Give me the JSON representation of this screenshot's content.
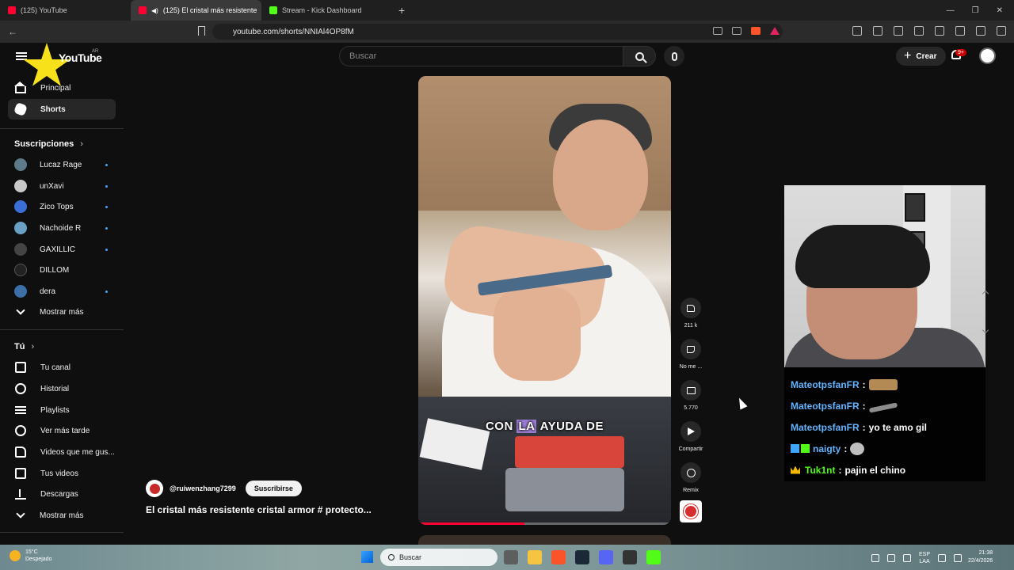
{
  "browser": {
    "tabs": [
      {
        "label": "(125) YouTube",
        "active": false
      },
      {
        "label": "(125) El cristal más resistente",
        "active": true
      },
      {
        "label": "Stream - Kick Dashboard",
        "active": false
      }
    ],
    "new_tab": "+",
    "url": "youtube.com/shorts/NNIAl4OP8fM"
  },
  "header": {
    "logo": "YouTube",
    "region": "AR",
    "search_placeholder": "Buscar",
    "create_label": "Crear",
    "notifications_badge": "9+"
  },
  "sidebar": {
    "main": [
      {
        "label": "Principal",
        "icon": "home-icon",
        "active": false
      },
      {
        "label": "Shorts",
        "icon": "shorts-icon",
        "active": true
      }
    ],
    "subscriptions_title": "Suscripciones",
    "subscriptions": [
      {
        "label": "Lucaz Rage",
        "color": "#5d7a8a",
        "live": true
      },
      {
        "label": "unXavi",
        "color": "#c9c9c9",
        "live": true
      },
      {
        "label": "Zico Tops",
        "color": "#3b6fd8",
        "live": true
      },
      {
        "label": "Nachoide R",
        "color": "#6aa0c4",
        "live": true
      },
      {
        "label": "GAXILLIC",
        "color": "#444444",
        "live": true
      },
      {
        "label": "DILLOM",
        "color": "#222222",
        "live": false
      },
      {
        "label": "dera",
        "color": "#3a6fa8",
        "live": true
      }
    ],
    "show_more_1": "Mostrar más",
    "you_title": "Tú",
    "you_items": [
      {
        "label": "Tu canal",
        "icon": "channel-icon"
      },
      {
        "label": "Historial",
        "icon": "history-icon"
      },
      {
        "label": "Playlists",
        "icon": "playlists-icon"
      },
      {
        "label": "Ver más tarde",
        "icon": "watch-later-icon"
      },
      {
        "label": "Videos que me gus...",
        "icon": "liked-videos-icon"
      },
      {
        "label": "Tus videos",
        "icon": "your-videos-icon"
      },
      {
        "label": "Descargas",
        "icon": "downloads-icon"
      }
    ],
    "show_more_2": "Mostrar más"
  },
  "short": {
    "caption_before": "CON",
    "caption_highlight": "LA",
    "caption_after": "AYUDA DE",
    "progress": 0.42,
    "channel": "@ruiwenzhang7299",
    "subscribe_label": "Suscribirse",
    "title": "El cristal más resistente cristal armor # protecto..."
  },
  "actions": {
    "likes": "211 k",
    "dislike": "No me ...",
    "comments": "5.770",
    "share": "Compartir",
    "remix": "Remix"
  },
  "chat": [
    {
      "user": "MateotpsfanFR",
      "text": "",
      "emote": "emote-a"
    },
    {
      "user": "MateotpsfanFR",
      "text": "",
      "emote": "emote-b"
    },
    {
      "user": "MateotpsfanFR",
      "text": "yo te amo gil",
      "emote": ""
    },
    {
      "user": "naigty",
      "text": "",
      "emote": "emote-c"
    },
    {
      "user": "Tuk1nt",
      "text": "pajin el chino",
      "emote": ""
    }
  ],
  "taskbar": {
    "weather_temp": "15°C",
    "weather_desc": "Despejado",
    "search_label": "Buscar",
    "lang_1": "ESP",
    "lang_2": "LAA",
    "time": "21:38",
    "date": "22/4/2026"
  }
}
